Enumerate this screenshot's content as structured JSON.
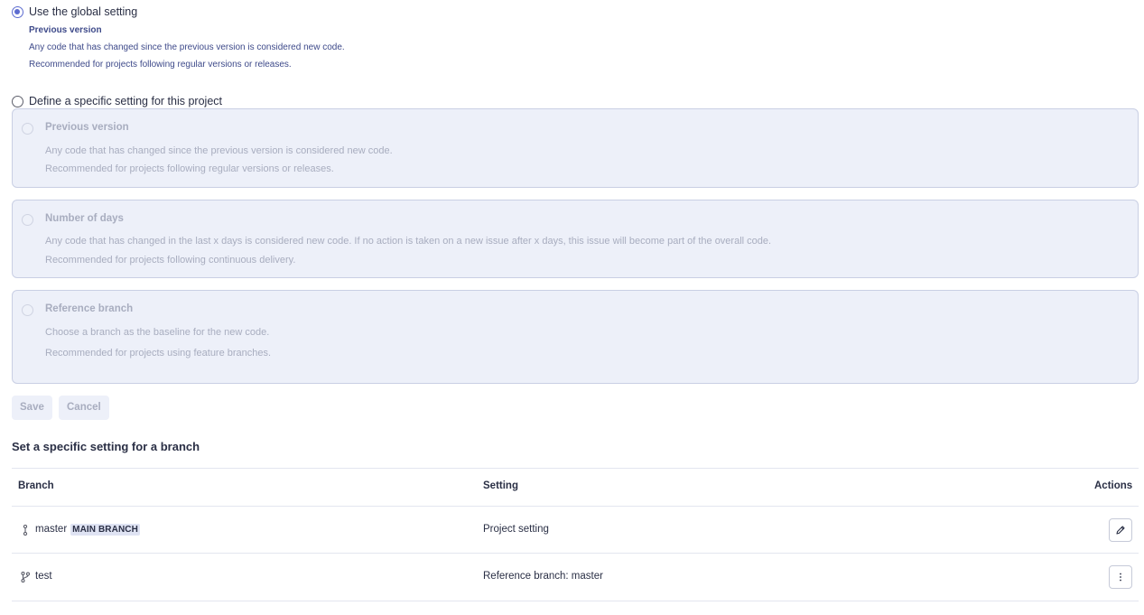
{
  "global": {
    "option_label": "Use the global setting",
    "title": "Previous version",
    "desc1": "Any code that has changed since the previous version is considered new code.",
    "desc2": "Recommended for projects following regular versions or releases."
  },
  "specific": {
    "option_label": "Define a specific setting for this project",
    "options": [
      {
        "title": "Previous version",
        "desc1": "Any code that has changed since the previous version is considered new code.",
        "desc2": "Recommended for projects following regular versions or releases."
      },
      {
        "title": "Number of days",
        "desc1": "Any code that has changed in the last x days is considered new code. If no action is taken on a new issue after x days, this issue will become part of the overall code.",
        "desc2": "Recommended for projects following continuous delivery."
      },
      {
        "title": "Reference branch",
        "desc1": "Choose a branch as the baseline for the new code.",
        "desc2": "Recommended for projects using feature branches."
      }
    ]
  },
  "buttons": {
    "save": "Save",
    "cancel": "Cancel"
  },
  "branch_section": {
    "title": "Set a specific setting for a branch",
    "columns": {
      "branch": "Branch",
      "setting": "Setting",
      "actions": "Actions"
    },
    "rows": [
      {
        "branch": "master",
        "badge": "MAIN BRANCH",
        "setting": "Project setting",
        "branch_icon": "main-branch-icon",
        "action_icon": "pencil-icon"
      },
      {
        "branch": "test",
        "badge": "",
        "setting": "Reference branch: master",
        "branch_icon": "git-branch-icon",
        "action_icon": "more-vertical-icon"
      }
    ]
  },
  "colors": {
    "accent": "#5d6cd0",
    "disabled_bg": "#edf0f9",
    "disabled_text": "#a8adbf"
  }
}
